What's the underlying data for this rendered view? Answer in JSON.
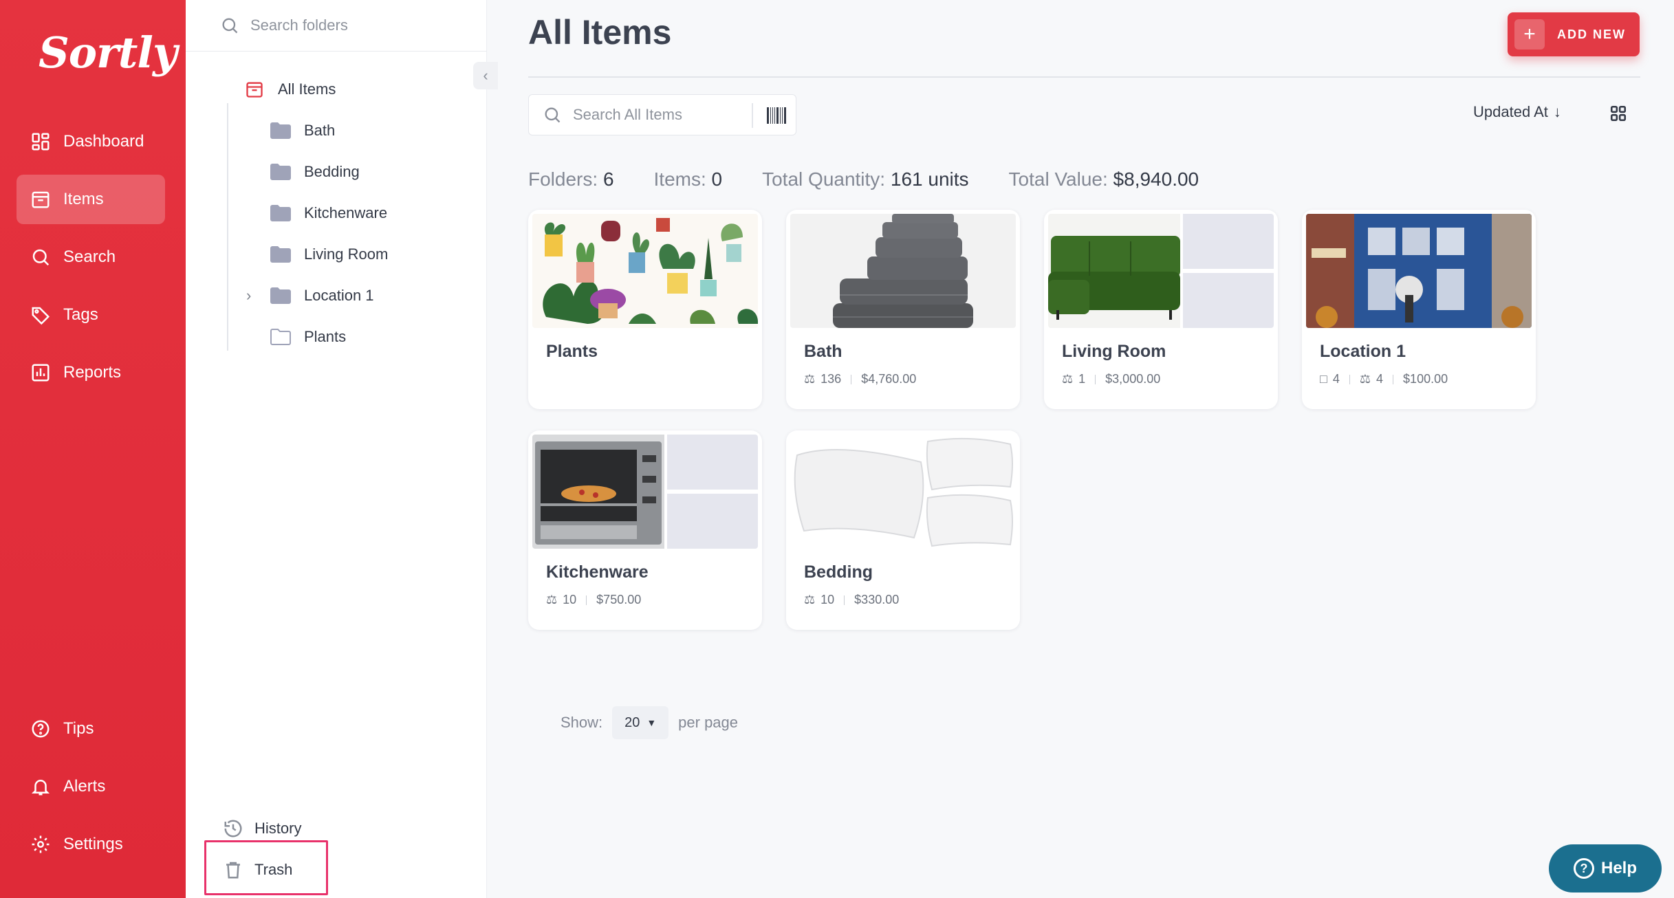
{
  "brand": {
    "logo_text": "Sortly",
    "accent": "#e23a45",
    "nav_bg": "#e12f3c",
    "help_bg": "#1b6f8f"
  },
  "nav": {
    "items": [
      {
        "label": "Dashboard",
        "icon": "dashboard-icon"
      },
      {
        "label": "Items",
        "icon": "items-icon",
        "active": true
      },
      {
        "label": "Search",
        "icon": "search-icon"
      },
      {
        "label": "Tags",
        "icon": "tag-icon"
      },
      {
        "label": "Reports",
        "icon": "reports-icon"
      }
    ],
    "bottom": [
      {
        "label": "Tips",
        "icon": "question-icon"
      },
      {
        "label": "Alerts",
        "icon": "bell-icon"
      },
      {
        "label": "Settings",
        "icon": "gear-icon"
      }
    ]
  },
  "folders": {
    "search_placeholder": "Search folders",
    "root": "All Items",
    "tree": [
      {
        "label": "Bath"
      },
      {
        "label": "Bedding"
      },
      {
        "label": "Kitchenware"
      },
      {
        "label": "Living Room"
      },
      {
        "label": "Location 1",
        "expandable": true
      },
      {
        "label": "Plants",
        "empty": true
      }
    ],
    "history": "History",
    "trash": "Trash"
  },
  "main": {
    "title": "All Items",
    "add_new": "ADD NEW",
    "search_placeholder": "Search All Items",
    "sort_label": "Updated At",
    "stats": {
      "folders_label": "Folders:",
      "folders_value": "6",
      "items_label": "Items:",
      "items_value": "0",
      "qty_label": "Total Quantity:",
      "qty_value": "161 units",
      "value_label": "Total Value:",
      "value_value": "$8,940.00"
    },
    "cards": [
      {
        "name": "Plants"
      },
      {
        "name": "Bath",
        "qty": "136",
        "value": "$4,760.00"
      },
      {
        "name": "Living Room",
        "qty": "1",
        "value": "$3,000.00"
      },
      {
        "name": "Location 1",
        "folders": "4",
        "qty": "4",
        "value": "$100.00"
      },
      {
        "name": "Kitchenware",
        "qty": "10",
        "value": "$750.00"
      },
      {
        "name": "Bedding",
        "qty": "10",
        "value": "$330.00"
      }
    ],
    "pager": {
      "show_label": "Show:",
      "page_size": "20",
      "per_page_label": "per page"
    }
  },
  "help": {
    "label": "Help"
  }
}
